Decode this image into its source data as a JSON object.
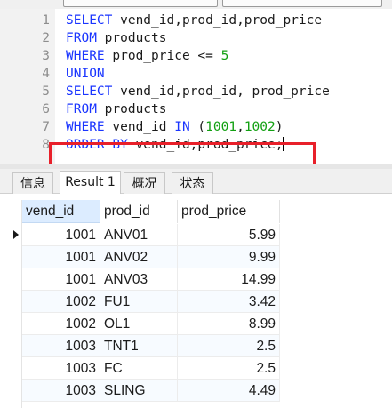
{
  "editor": {
    "lines": [
      {
        "num": "1",
        "parts": [
          [
            "kw",
            "SELECT"
          ],
          [
            "txt",
            " vend_id,prod_id,prod_price"
          ]
        ]
      },
      {
        "num": "2",
        "parts": [
          [
            "kw",
            "FROM"
          ],
          [
            "txt",
            " products"
          ]
        ]
      },
      {
        "num": "3",
        "parts": [
          [
            "kw",
            "WHERE"
          ],
          [
            "txt",
            " prod_price <= "
          ],
          [
            "num",
            "5"
          ]
        ]
      },
      {
        "num": "4",
        "parts": [
          [
            "kw",
            "UNION"
          ]
        ]
      },
      {
        "num": "5",
        "parts": [
          [
            "kw",
            "SELECT"
          ],
          [
            "txt",
            " vend_id,prod_id, prod_price"
          ]
        ]
      },
      {
        "num": "6",
        "parts": [
          [
            "kw",
            "FROM"
          ],
          [
            "txt",
            " products"
          ]
        ]
      },
      {
        "num": "7",
        "parts": [
          [
            "kw",
            "WHERE"
          ],
          [
            "txt",
            " vend_id "
          ],
          [
            "kw",
            "IN"
          ],
          [
            "txt",
            " ("
          ],
          [
            "num",
            "1001"
          ],
          [
            "txt",
            ","
          ],
          [
            "num",
            "1002"
          ],
          [
            "txt",
            ")"
          ]
        ]
      },
      {
        "num": "8",
        "parts": [
          [
            "kw",
            "ORDER BY"
          ],
          [
            "txt",
            " vend_id,prod_price;"
          ]
        ]
      }
    ],
    "colors": {
      "keyword": "#1a35ff",
      "number": "#12a012",
      "highlight_box": "#e8202a"
    }
  },
  "tabs": [
    {
      "label": "信息",
      "active": false
    },
    {
      "label": "Result 1",
      "active": true
    },
    {
      "label": "概况",
      "active": false
    },
    {
      "label": "状态",
      "active": false
    }
  ],
  "grid": {
    "columns": [
      "vend_id",
      "prod_id",
      "prod_price"
    ],
    "sorted_column": "vend_id",
    "rows": [
      [
        "1001",
        "ANV01",
        "5.99"
      ],
      [
        "1001",
        "ANV02",
        "9.99"
      ],
      [
        "1001",
        "ANV03",
        "14.99"
      ],
      [
        "1002",
        "FU1",
        "3.42"
      ],
      [
        "1002",
        "OL1",
        "8.99"
      ],
      [
        "1003",
        "TNT1",
        "2.5"
      ],
      [
        "1003",
        "FC",
        "2.5"
      ],
      [
        "1003",
        "SLING",
        "4.49"
      ]
    ],
    "selected_row": 0
  }
}
